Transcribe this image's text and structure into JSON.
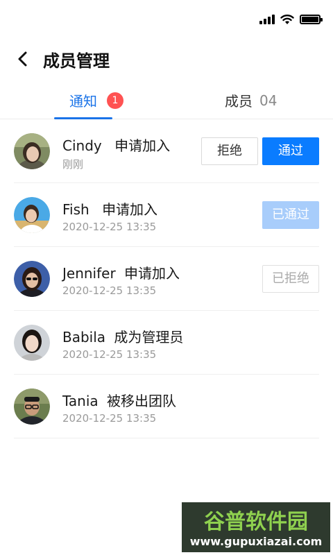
{
  "header": {
    "title": "成员管理"
  },
  "tabs": [
    {
      "label": "通知",
      "badge": "1"
    },
    {
      "label": "成员",
      "count": "04"
    }
  ],
  "rows": [
    {
      "name": "Cindy",
      "action": "申请加入",
      "time": "刚刚",
      "reject_label": "拒绝",
      "approve_label": "通过"
    },
    {
      "name": "Fish",
      "action": "申请加入",
      "time": "2020-12-25  13:35",
      "status_label": "已通过"
    },
    {
      "name": "Jennifer",
      "action": "申请加入",
      "time": "2020-12-25  13:35",
      "status_label": "已拒绝"
    },
    {
      "name": "Babila",
      "action": "成为管理员",
      "time": "2020-12-25  13:35"
    },
    {
      "name": "Tania",
      "action": "被移出团队",
      "time": "2020-12-25  13:35"
    }
  ],
  "watermark": {
    "title": "谷普软件园",
    "url": "www.gupuxiazai.com"
  },
  "colors": {
    "accent": "#0a7cff",
    "tab_active": "#1a73e8",
    "badge": "#ff5252",
    "approved": "#a8cdfb"
  },
  "icons": {
    "back": "chevron-left-icon",
    "signal": "signal-icon",
    "wifi": "wifi-icon",
    "battery": "battery-icon"
  }
}
